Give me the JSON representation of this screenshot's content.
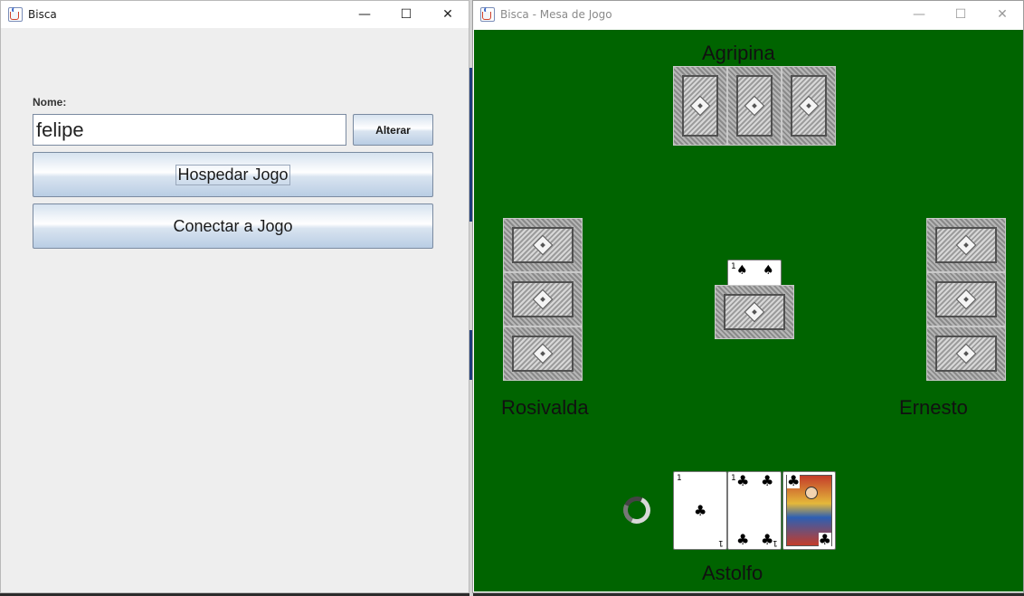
{
  "left_window": {
    "title": "Bisca",
    "name_label": "Nome:",
    "name_value": "felipe",
    "alterar_label": "Alterar",
    "hospedar_label": "Hospedar Jogo",
    "conectar_label": "Conectar a Jogo"
  },
  "right_window": {
    "title": "Bisca - Mesa de Jogo",
    "players": {
      "top": "Agripina",
      "left": "Rosivalda",
      "right": "Ernesto",
      "bottom": "Astolfo"
    }
  },
  "controls": {
    "minimize": "—",
    "maximize": "☐",
    "close": "✕"
  },
  "cards": {
    "spade": "♠",
    "club": "♣",
    "rank_one": "1"
  },
  "colors": {
    "table": "#006400",
    "window_bg": "#eeeeee"
  }
}
